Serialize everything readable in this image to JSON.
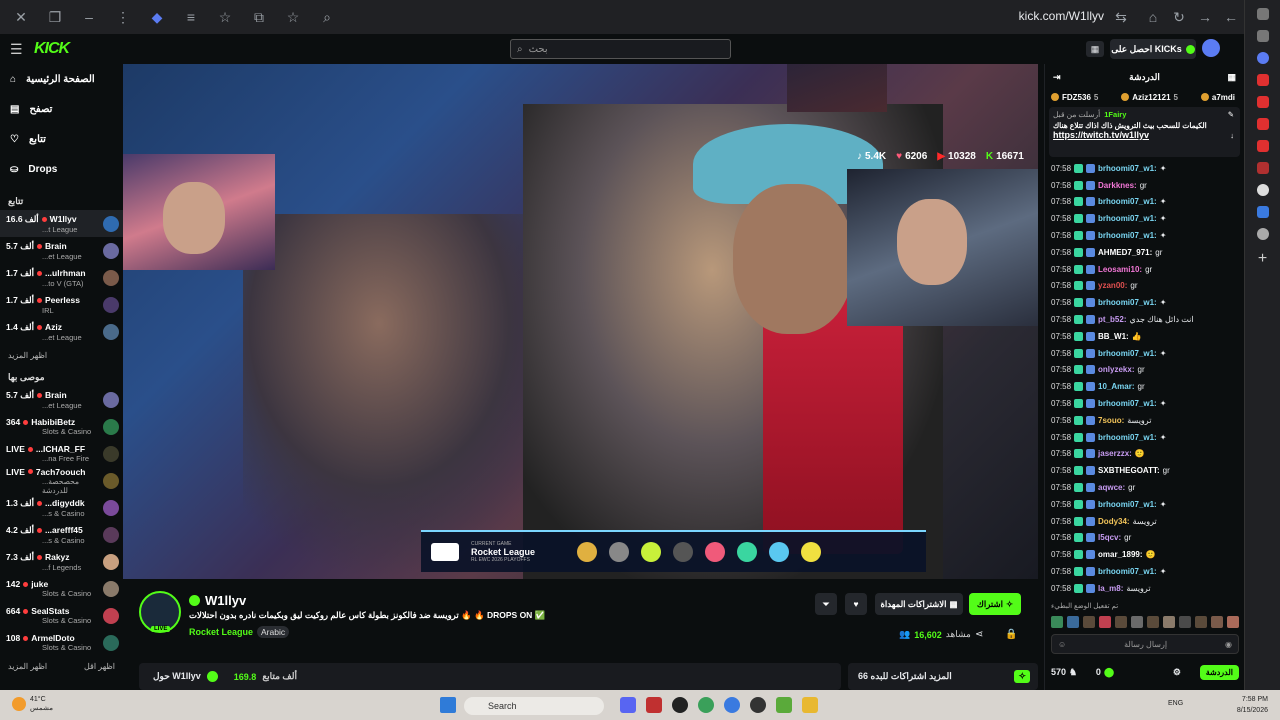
{
  "browser": {
    "url": "kick.com/W1llyv"
  },
  "header": {
    "logo": "KICK",
    "search_placeholder": "بحث",
    "get_kicks": "احصل على KICKs"
  },
  "sidebar": {
    "nav": [
      {
        "label": "الصفحة الرئيسية",
        "icon": "home-icon"
      },
      {
        "label": "تصفح",
        "icon": "browse-icon"
      },
      {
        "label": "تتابع",
        "icon": "heart-icon"
      },
      {
        "label": "Drops",
        "icon": "drops-icon"
      }
    ],
    "following_title": "تتابع",
    "following": [
      {
        "count": "16.6 ألف",
        "name": "W1llyv",
        "game": "...t League",
        "color": "#2f6bb0"
      },
      {
        "count": "5.7 ألف",
        "name": "Brain",
        "game": "...et League",
        "color": "#6a6aa0"
      },
      {
        "count": "1.7 ألف",
        "name": "...ulrhman",
        "game": "...to V (GTA)",
        "color": "#7a5a4a"
      },
      {
        "count": "1.7 ألف",
        "name": "Peerless",
        "game": "IRL",
        "color": "#4a3a6a"
      },
      {
        "count": "1.4 ألف",
        "name": "Aziz",
        "game": "...et League",
        "color": "#4a6a8a"
      }
    ],
    "more1": "اظهر المزيد",
    "recommended_title": "موصى بها",
    "recommended": [
      {
        "count": "5.7 ألف",
        "name": "Brain",
        "game": "...et League",
        "color": "#6a6aa0"
      },
      {
        "count": "364",
        "name": "HabibiBetz",
        "game": "Slots & Casino",
        "color": "#2a7a4a"
      },
      {
        "count": "LIVE",
        "name": "...ICHAR_FF",
        "game": "...na Free Fire",
        "color": "#3a3a2a"
      },
      {
        "count": "LIVE",
        "name": "7ach7oouch",
        "game": "...محصحصة للدردشة",
        "color": "#6a5a2a"
      },
      {
        "count": "1.3 ألف",
        "name": "...digyddk",
        "game": "...s & Casino",
        "color": "#7a4a9a"
      },
      {
        "count": "4.2 ألف",
        "name": "...arefff45",
        "game": "...s & Casino",
        "color": "#5a3a5a"
      },
      {
        "count": "7.3 ألف",
        "name": "Rakyz",
        "game": "...f Legends",
        "color": "#c8a080"
      },
      {
        "count": "142",
        "name": "juke",
        "game": "Slots & Casino",
        "color": "#8a7a6a"
      },
      {
        "count": "664",
        "name": "SealStats",
        "game": "Slots & Casino",
        "color": "#c04050"
      },
      {
        "count": "108",
        "name": "ArmelDoto",
        "game": "Slots & Casino",
        "color": "#2a6a5a"
      }
    ],
    "more2_left": "اظهر المزيد",
    "more2_right": "اظهر اقل"
  },
  "video": {
    "stats": {
      "tiktok": "5.4K",
      "hearts": "6206",
      "youtube": "10328",
      "kick": "16671"
    },
    "scoreboard": {
      "label": "CURRENT GAME",
      "game": "Rocket League",
      "event": "RL EWC 2026 PLAYOFFS"
    }
  },
  "stream": {
    "name": "W1llyv",
    "title": "ترويسة ضد فالكونز بطولة كاس عالم روكيت ليق وبكيمات نادره بدون احتلالات 🔥 🔥 DROPS ON ✅",
    "category": "Rocket League",
    "language": "Arabic",
    "live": "LIVE",
    "follow": "اشتراك",
    "gift_subs": "الاشتراكات المهداة",
    "viewers": "16,602",
    "viewers_label": "مشاهد",
    "about": "حول W1llyv",
    "followers": "169.8",
    "followers_label": "ألف متابع",
    "subs_box": "المزيد اشتراكات للبده 66"
  },
  "chat": {
    "title": "الدردشة",
    "leaders": [
      {
        "name": "FDZ536",
        "n": "5"
      },
      {
        "name": "Aziz12121",
        "n": "5"
      },
      {
        "name": "a7mdi",
        "n": ""
      }
    ],
    "pinned": {
      "user": "1Fairy",
      "meta": "أرسلت من قبل",
      "text": "الكيمات للسحب بيث الترويش ذاك اذاك تتلاع هناك",
      "link": "https://twitch.tv/w1llyv"
    },
    "messages": [
      {
        "t": "07:58",
        "n": "brhoomi07_w1:",
        "m": "✦",
        "c": "#7ad6f2"
      },
      {
        "t": "07:58",
        "n": "Darkknes:",
        "m": "gr",
        "c": "#f277d6"
      },
      {
        "t": "07:58",
        "n": "brhoomi07_w1:",
        "m": "✦",
        "c": "#7ad6f2"
      },
      {
        "t": "07:58",
        "n": "brhoomi07_w1:",
        "m": "✦",
        "c": "#7ad6f2"
      },
      {
        "t": "07:58",
        "n": "brhoomi07_w1:",
        "m": "✦",
        "c": "#7ad6f2"
      },
      {
        "t": "07:58",
        "n": "AHMED7_971:",
        "m": "gr",
        "c": "#ffffff"
      },
      {
        "t": "07:58",
        "n": "Leosami10:",
        "m": "gr",
        "c": "#f277d6"
      },
      {
        "t": "07:58",
        "n": "yzan00:",
        "m": "gr",
        "c": "#e05050"
      },
      {
        "t": "07:58",
        "n": "brhoomi07_w1:",
        "m": "✦",
        "c": "#7ad6f2"
      },
      {
        "t": "07:58",
        "n": "pt_b52:",
        "m": "انت دائل هناك جدي",
        "c": "#c89cf2"
      },
      {
        "t": "07:58",
        "n": "BB_W1:",
        "m": "👍",
        "c": "#ffffff"
      },
      {
        "t": "07:58",
        "n": "brhoomi07_w1:",
        "m": "✦",
        "c": "#7ad6f2"
      },
      {
        "t": "07:58",
        "n": "onlyzekx:",
        "m": "gr",
        "c": "#c89cf2"
      },
      {
        "t": "07:58",
        "n": "10_Amar:",
        "m": "gr",
        "c": "#7ad6f2"
      },
      {
        "t": "07:58",
        "n": "brhoomi07_w1:",
        "m": "✦",
        "c": "#7ad6f2"
      },
      {
        "t": "07:58",
        "n": "7souo:",
        "m": "ترويسة",
        "c": "#f2c45a"
      },
      {
        "t": "07:58",
        "n": "brhoomi07_w1:",
        "m": "✦",
        "c": "#7ad6f2"
      },
      {
        "t": "07:58",
        "n": "jaserzzx:",
        "m": "🙂",
        "c": "#c89cf2"
      },
      {
        "t": "07:58",
        "n": "SXBTHEGOATT:",
        "m": "gr",
        "c": "#ffffff"
      },
      {
        "t": "07:58",
        "n": "aqwce:",
        "m": "gr",
        "c": "#c89cf2"
      },
      {
        "t": "07:58",
        "n": "brhoomi07_w1:",
        "m": "✦",
        "c": "#7ad6f2"
      },
      {
        "t": "07:58",
        "n": "Dody34:",
        "m": "ترويسة",
        "c": "#f2c45a"
      },
      {
        "t": "07:58",
        "n": "l5qcv:",
        "m": "gr",
        "c": "#c89cf2"
      },
      {
        "t": "07:58",
        "n": "omar_1899:",
        "m": "🙂",
        "c": "#ffffff"
      },
      {
        "t": "07:58",
        "n": "brhoomi07_w1:",
        "m": "✦",
        "c": "#7ad6f2"
      },
      {
        "t": "07:58",
        "n": "la_m8:",
        "m": "ترويسة",
        "c": "#c89cf2"
      }
    ],
    "typing": "تم تفعيل الوضع البطيء",
    "input_placeholder": "إرسال رسالة",
    "points": "570",
    "kicks": "0",
    "send": "الدردشة"
  },
  "taskbar": {
    "temp": "41°C",
    "weather": "مشمس",
    "search": "Search",
    "lang": "ENG",
    "time": "7:58 PM",
    "date": "8/15/2026"
  }
}
